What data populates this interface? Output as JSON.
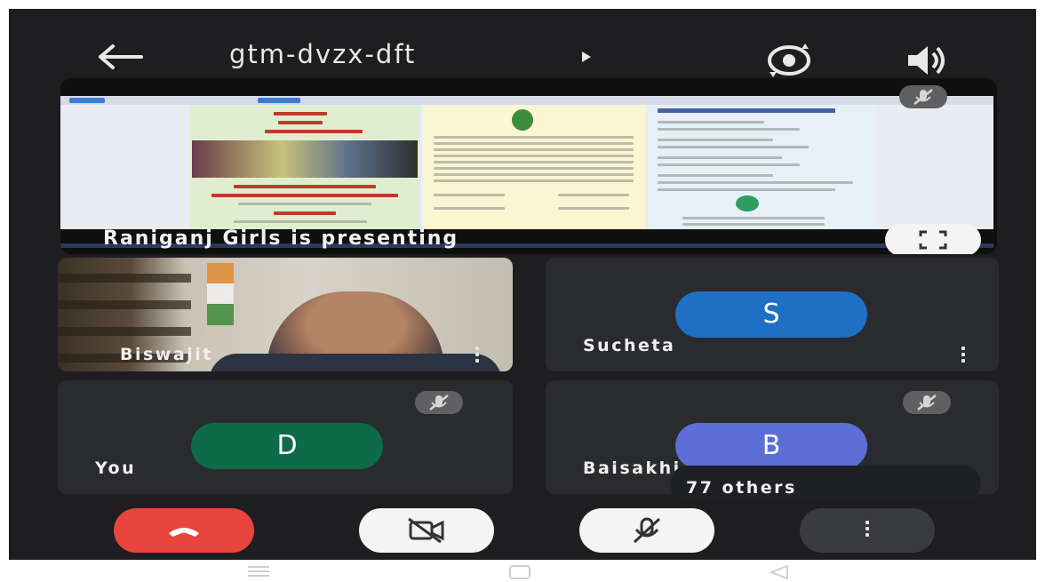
{
  "header": {
    "meeting_code": "gtm-dvzx-dft",
    "back_icon": "arrow-left-icon",
    "switch_camera_icon": "camera-switch-icon",
    "audio_output_icon": "speaker-icon"
  },
  "presentation": {
    "label": "Raniganj Girls is presenting",
    "muted_icon": "mic-off-icon",
    "fullscreen_icon": "fullscreen-icon"
  },
  "participants": [
    {
      "name": "Biswajit",
      "type": "video"
    },
    {
      "name": "Sucheta",
      "initial": "S",
      "avatar_color": "#1f6fc4"
    },
    {
      "name": "You",
      "initial": "D",
      "avatar_color": "#0d6b4a",
      "muted": true
    },
    {
      "name": "Baisakhi",
      "initial": "B",
      "avatar_color": "#5c6fd6",
      "muted": true
    }
  ],
  "others_count_label": "77 others",
  "controls": {
    "end_call_icon": "end-call-icon",
    "camera_off_icon": "camera-off-icon",
    "mic_off_icon": "mic-off-icon",
    "more_icon": "more-vertical-icon",
    "end_call_color": "#e8453c"
  },
  "android_nav": [
    "menu-icon",
    "home-icon",
    "back-triangle-icon"
  ]
}
